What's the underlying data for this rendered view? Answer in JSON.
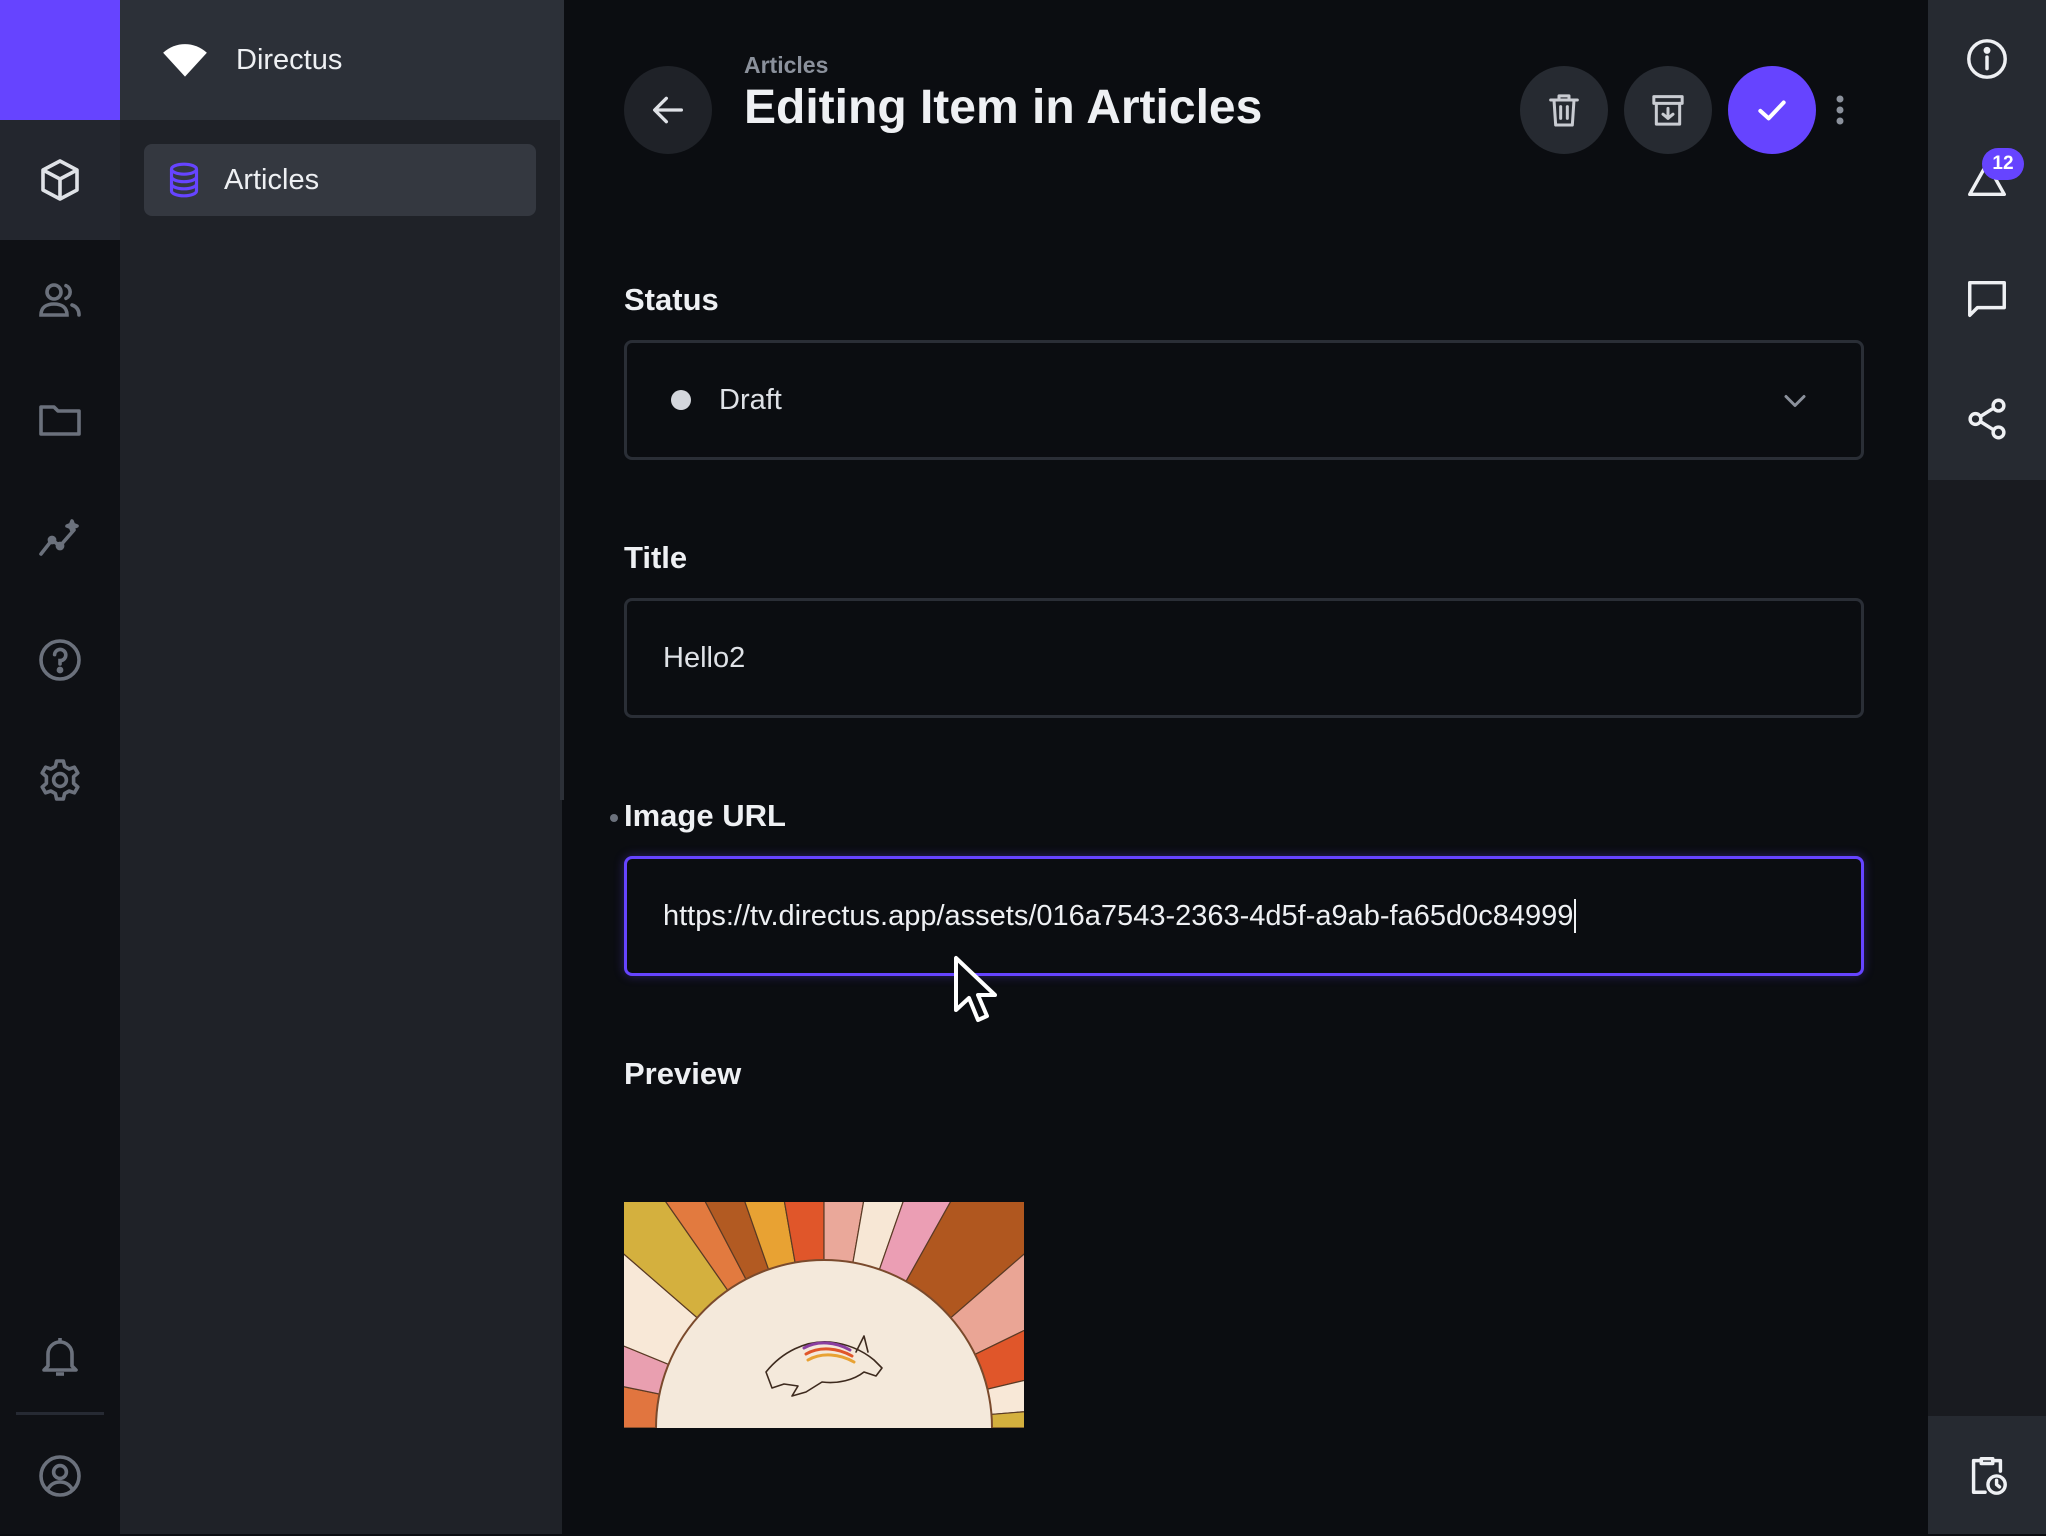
{
  "app": {
    "project_name": "Directus",
    "brand_color": "#6644ff"
  },
  "rail": {
    "items": [
      {
        "icon": "content-cube-icon",
        "active": true
      },
      {
        "icon": "users-icon"
      },
      {
        "icon": "folder-icon"
      },
      {
        "icon": "insights-icon"
      },
      {
        "icon": "help-icon"
      },
      {
        "icon": "settings-gear-icon"
      }
    ],
    "bottom": [
      {
        "icon": "notifications-bell-icon"
      },
      {
        "icon": "user-account-icon"
      }
    ]
  },
  "nav": {
    "collection_label": "Articles",
    "collection_icon": "database-icon"
  },
  "header": {
    "breadcrumb": "Articles",
    "title": "Editing Item in Articles",
    "back_icon": "arrow-back-icon",
    "actions": [
      {
        "name": "delete",
        "icon": "trash-icon"
      },
      {
        "name": "archive",
        "icon": "archive-icon"
      },
      {
        "name": "save",
        "icon": "check-icon"
      },
      {
        "name": "more",
        "icon": "more-vertical-icon"
      }
    ]
  },
  "form": {
    "status": {
      "label": "Status",
      "value": "Draft"
    },
    "title": {
      "label": "Title",
      "value": "Hello2"
    },
    "image_url": {
      "label": "Image URL",
      "value": "https://tv.directus.app/assets/016a7543-2363-4d5f-a9ab-fa65d0c84999"
    },
    "preview": {
      "label": "Preview"
    }
  },
  "sidebar": {
    "items": [
      {
        "icon": "info-icon"
      },
      {
        "icon": "revisions-icon",
        "badge": "12"
      },
      {
        "icon": "comments-icon"
      },
      {
        "icon": "share-icon"
      }
    ],
    "bottom_icon": "scheduled-clipboard-icon"
  }
}
